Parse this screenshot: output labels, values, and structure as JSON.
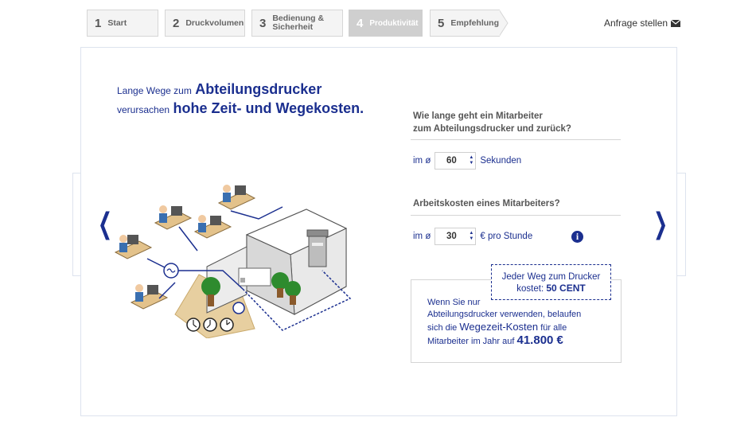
{
  "steps": [
    {
      "num": "1",
      "label": "Start"
    },
    {
      "num": "2",
      "label": "Druckvolumen"
    },
    {
      "num": "3",
      "label": "Bedienung & Sicherheit"
    },
    {
      "num": "4",
      "label": "Produktivität"
    },
    {
      "num": "5",
      "label": "Empfehlung"
    }
  ],
  "active_step": 4,
  "header": {
    "request_label": "Anfrage stellen",
    "request_icon": "envelope-icon"
  },
  "headline": {
    "pre1": "Lange Wege zum",
    "strong1": "Abteilungsdrucker",
    "pre2": "verursachen",
    "strong2": "hohe Zeit- und Wegekosten."
  },
  "question1": {
    "text_line1": "Wie lange geht ein Mitarbeiter",
    "text_line2": "zum Abteilungsdrucker und zurück?",
    "prefix": "im ø",
    "value": "60",
    "unit": "Sekunden"
  },
  "question2": {
    "text": "Arbeitskosten eines Mitarbeiters?",
    "prefix": "im ø",
    "value": "30",
    "unit": "€ pro Stunde"
  },
  "info_icon": "i",
  "callout": {
    "line1": "Jeder Weg zum Drucker",
    "line2": "kostet:",
    "amount": "50 CENT"
  },
  "result": {
    "line1": "Wenn Sie nur",
    "line2": "Abteilungsdrucker verwenden, belaufen",
    "line3_pre": "sich die",
    "line3_strong": "Wegezeit-Kosten",
    "line3_post": "für alle",
    "line4_pre": "Mitarbeiter im Jahr auf",
    "line4_amount": "41.800 €"
  },
  "nav": {
    "prev": "❮",
    "next": "❯"
  },
  "colors": {
    "brand": "#1b2f8f",
    "active_step": "#cfcfcf",
    "floor": "#e7cfa0"
  }
}
